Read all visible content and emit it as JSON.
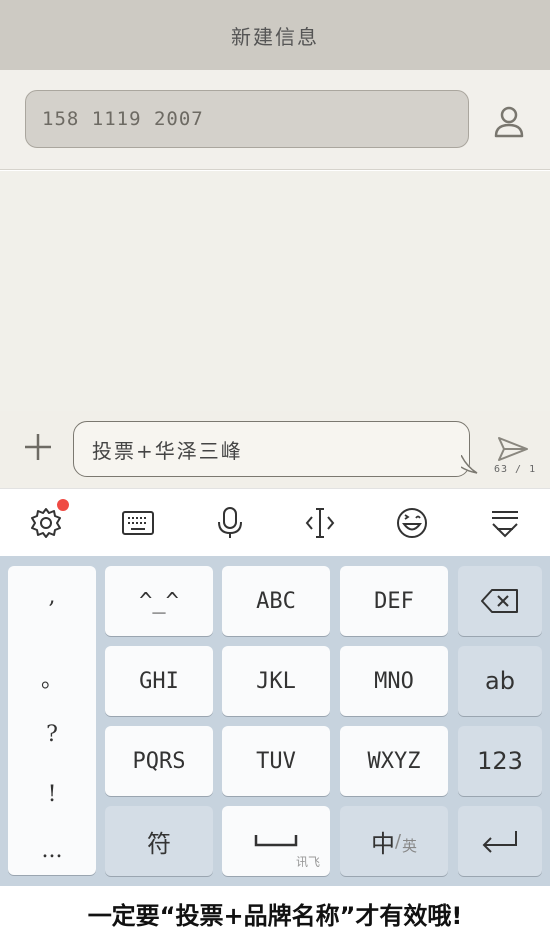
{
  "header": {
    "title": "新建信息"
  },
  "recipient": {
    "value": "158 1119 2007"
  },
  "compose": {
    "text": "投票+华泽三峰",
    "char_count": "63 / 1"
  },
  "ime_toolbar": {
    "icons": [
      "gear-icon",
      "keyboard-icon",
      "microphone-icon",
      "cursor-icon",
      "emoji-icon",
      "hide-keyboard-icon"
    ],
    "notification_color": "#ef4a43"
  },
  "keyboard": {
    "punctuation": [
      ",",
      "。",
      "?",
      "!",
      "..."
    ],
    "row1": [
      "^_^",
      "ABC",
      "DEF"
    ],
    "row2": [
      "GHI",
      "JKL",
      "MNO",
      "ab"
    ],
    "row3": [
      "PQRS",
      "TUV",
      "WXYZ",
      "123"
    ],
    "row4": {
      "symbol": "符",
      "space_brand": "讯飞",
      "lang_main": "中",
      "lang_sep": "/",
      "lang_alt": "英"
    },
    "colors": {
      "background": "#c7d3de",
      "key": "#fafbfc",
      "func_key": "#d4dde6"
    }
  },
  "caption": "一定要“投票+品牌名称”才有效哦!"
}
